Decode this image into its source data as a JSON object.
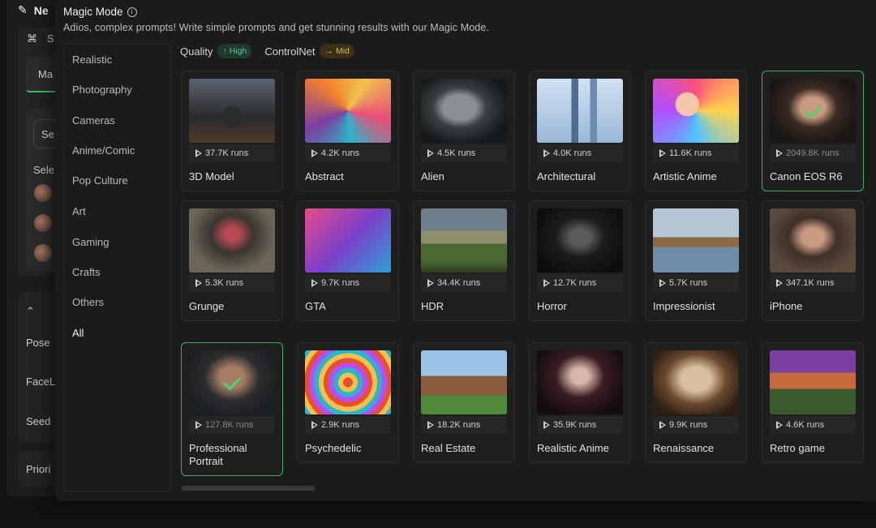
{
  "background": {
    "title": "Ne",
    "row1_text": "S",
    "tab_label": "Ma",
    "select_label": "Se",
    "select_caption": "Sele",
    "labels": [
      "Pose",
      "FaceL",
      "Seed"
    ],
    "priority_label": "Priori"
  },
  "modal": {
    "title": "Magic Mode",
    "subtitle": "Adios, complex prompts! Write simple prompts and get stunning results with our Magic Mode.",
    "categories": [
      "Realistic",
      "Photography",
      "Cameras",
      "Anime/Comic",
      "Pop Culture",
      "Art",
      "Gaming",
      "Crafts",
      "Others",
      "All"
    ],
    "active_category": "All",
    "filters": {
      "quality_label": "Quality",
      "quality_value": "High",
      "controlnet_label": "ControlNet",
      "controlnet_value": "Mid"
    },
    "styles": [
      {
        "name": "3D Model",
        "runs": "37.7K runs"
      },
      {
        "name": "Abstract",
        "runs": "4.2K runs"
      },
      {
        "name": "Alien",
        "runs": "4.5K runs"
      },
      {
        "name": "Architectural",
        "runs": "4.0K runs"
      },
      {
        "name": "Artistic Anime",
        "runs": "11.6K runs"
      },
      {
        "name": "Canon EOS R6",
        "runs": "2049.8K runs",
        "selected": true
      },
      {
        "name": "Grunge",
        "runs": "5.3K runs"
      },
      {
        "name": "GTA",
        "runs": "9.7K runs"
      },
      {
        "name": "HDR",
        "runs": "34.4K runs"
      },
      {
        "name": "Horror",
        "runs": "12.7K runs"
      },
      {
        "name": "Impressionist",
        "runs": "5.7K runs"
      },
      {
        "name": "iPhone",
        "runs": "347.1K runs"
      },
      {
        "name": "Professional Portrait",
        "runs": "127.8K runs",
        "selected": true
      },
      {
        "name": "Psychedelic",
        "runs": "2.9K runs"
      },
      {
        "name": "Real Estate",
        "runs": "18.2K runs"
      },
      {
        "name": "Realistic Anime",
        "runs": "35.9K runs"
      },
      {
        "name": "Renaissance",
        "runs": "9.9K runs"
      },
      {
        "name": "Retro game",
        "runs": "4.6K runs"
      }
    ],
    "colors": {
      "selected_border": "#3fae63",
      "quality_high": "#4fd28a",
      "controlnet_mid": "#e8b54a"
    }
  }
}
